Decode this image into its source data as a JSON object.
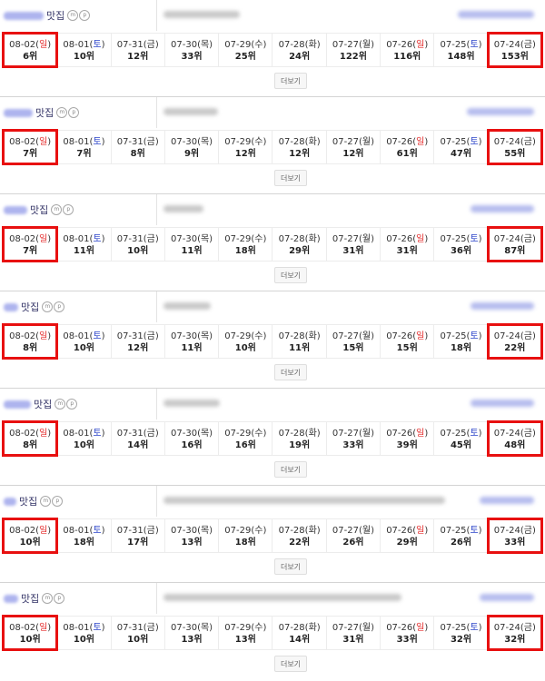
{
  "more_label": "더보기",
  "badge_m": "m",
  "badge_p": "p",
  "colors": {
    "highlight": "#e81010",
    "sunday": "#e42b2b",
    "saturday": "#2c44c9"
  },
  "blocks": [
    {
      "keyword_suffix": "맛집",
      "days": [
        {
          "date": "08-02",
          "dow": "일",
          "rank": "6위",
          "highlight": true
        },
        {
          "date": "08-01",
          "dow": "토",
          "rank": "10위"
        },
        {
          "date": "07-31",
          "dow": "금",
          "rank": "12위"
        },
        {
          "date": "07-30",
          "dow": "목",
          "rank": "33위"
        },
        {
          "date": "07-29",
          "dow": "수",
          "rank": "25위"
        },
        {
          "date": "07-28",
          "dow": "화",
          "rank": "24위"
        },
        {
          "date": "07-27",
          "dow": "월",
          "rank": "122위"
        },
        {
          "date": "07-26",
          "dow": "일",
          "rank": "116위"
        },
        {
          "date": "07-25",
          "dow": "토",
          "rank": "148위"
        },
        {
          "date": "07-24",
          "dow": "금",
          "rank": "153위",
          "highlight": true
        }
      ]
    },
    {
      "keyword_suffix": "맛집",
      "days": [
        {
          "date": "08-02",
          "dow": "일",
          "rank": "7위",
          "highlight": true
        },
        {
          "date": "08-01",
          "dow": "토",
          "rank": "7위"
        },
        {
          "date": "07-31",
          "dow": "금",
          "rank": "8위"
        },
        {
          "date": "07-30",
          "dow": "목",
          "rank": "9위"
        },
        {
          "date": "07-29",
          "dow": "수",
          "rank": "12위"
        },
        {
          "date": "07-28",
          "dow": "화",
          "rank": "12위"
        },
        {
          "date": "07-27",
          "dow": "월",
          "rank": "12위"
        },
        {
          "date": "07-26",
          "dow": "일",
          "rank": "61위"
        },
        {
          "date": "07-25",
          "dow": "토",
          "rank": "47위"
        },
        {
          "date": "07-24",
          "dow": "금",
          "rank": "55위",
          "highlight": true
        }
      ]
    },
    {
      "keyword_suffix": "맛집",
      "days": [
        {
          "date": "08-02",
          "dow": "일",
          "rank": "7위",
          "highlight": true
        },
        {
          "date": "08-01",
          "dow": "토",
          "rank": "11위"
        },
        {
          "date": "07-31",
          "dow": "금",
          "rank": "10위"
        },
        {
          "date": "07-30",
          "dow": "목",
          "rank": "11위"
        },
        {
          "date": "07-29",
          "dow": "수",
          "rank": "18위"
        },
        {
          "date": "07-28",
          "dow": "화",
          "rank": "29위"
        },
        {
          "date": "07-27",
          "dow": "월",
          "rank": "31위"
        },
        {
          "date": "07-26",
          "dow": "일",
          "rank": "31위"
        },
        {
          "date": "07-25",
          "dow": "토",
          "rank": "36위"
        },
        {
          "date": "07-24",
          "dow": "금",
          "rank": "87위",
          "highlight": true
        }
      ]
    },
    {
      "keyword_suffix": "맛집",
      "days": [
        {
          "date": "08-02",
          "dow": "일",
          "rank": "8위",
          "highlight": true
        },
        {
          "date": "08-01",
          "dow": "토",
          "rank": "10위"
        },
        {
          "date": "07-31",
          "dow": "금",
          "rank": "12위"
        },
        {
          "date": "07-30",
          "dow": "목",
          "rank": "11위"
        },
        {
          "date": "07-29",
          "dow": "수",
          "rank": "10위"
        },
        {
          "date": "07-28",
          "dow": "화",
          "rank": "11위"
        },
        {
          "date": "07-27",
          "dow": "월",
          "rank": "15위"
        },
        {
          "date": "07-26",
          "dow": "일",
          "rank": "15위"
        },
        {
          "date": "07-25",
          "dow": "토",
          "rank": "18위"
        },
        {
          "date": "07-24",
          "dow": "금",
          "rank": "22위",
          "highlight": true
        }
      ]
    },
    {
      "keyword_suffix": "맛집",
      "days": [
        {
          "date": "08-02",
          "dow": "일",
          "rank": "8위",
          "highlight": true
        },
        {
          "date": "08-01",
          "dow": "토",
          "rank": "10위"
        },
        {
          "date": "07-31",
          "dow": "금",
          "rank": "14위"
        },
        {
          "date": "07-30",
          "dow": "목",
          "rank": "16위"
        },
        {
          "date": "07-29",
          "dow": "수",
          "rank": "16위"
        },
        {
          "date": "07-28",
          "dow": "화",
          "rank": "19위"
        },
        {
          "date": "07-27",
          "dow": "월",
          "rank": "33위"
        },
        {
          "date": "07-26",
          "dow": "일",
          "rank": "39위"
        },
        {
          "date": "07-25",
          "dow": "토",
          "rank": "45위"
        },
        {
          "date": "07-24",
          "dow": "금",
          "rank": "48위",
          "highlight": true
        }
      ]
    },
    {
      "keyword_suffix": "맛집",
      "days": [
        {
          "date": "08-02",
          "dow": "일",
          "rank": "10위",
          "highlight": true
        },
        {
          "date": "08-01",
          "dow": "토",
          "rank": "18위"
        },
        {
          "date": "07-31",
          "dow": "금",
          "rank": "17위"
        },
        {
          "date": "07-30",
          "dow": "목",
          "rank": "13위"
        },
        {
          "date": "07-29",
          "dow": "수",
          "rank": "18위"
        },
        {
          "date": "07-28",
          "dow": "화",
          "rank": "22위"
        },
        {
          "date": "07-27",
          "dow": "월",
          "rank": "26위"
        },
        {
          "date": "07-26",
          "dow": "일",
          "rank": "29위"
        },
        {
          "date": "07-25",
          "dow": "토",
          "rank": "26위"
        },
        {
          "date": "07-24",
          "dow": "금",
          "rank": "33위",
          "highlight": true
        }
      ]
    },
    {
      "keyword_suffix": "맛집",
      "days": [
        {
          "date": "08-02",
          "dow": "일",
          "rank": "10위",
          "highlight": true
        },
        {
          "date": "08-01",
          "dow": "토",
          "rank": "10위"
        },
        {
          "date": "07-31",
          "dow": "금",
          "rank": "10위"
        },
        {
          "date": "07-30",
          "dow": "목",
          "rank": "13위"
        },
        {
          "date": "07-29",
          "dow": "수",
          "rank": "13위"
        },
        {
          "date": "07-28",
          "dow": "화",
          "rank": "14위"
        },
        {
          "date": "07-27",
          "dow": "월",
          "rank": "31위"
        },
        {
          "date": "07-26",
          "dow": "일",
          "rank": "33위"
        },
        {
          "date": "07-25",
          "dow": "토",
          "rank": "32위"
        },
        {
          "date": "07-24",
          "dow": "금",
          "rank": "32위",
          "highlight": true
        }
      ]
    }
  ]
}
